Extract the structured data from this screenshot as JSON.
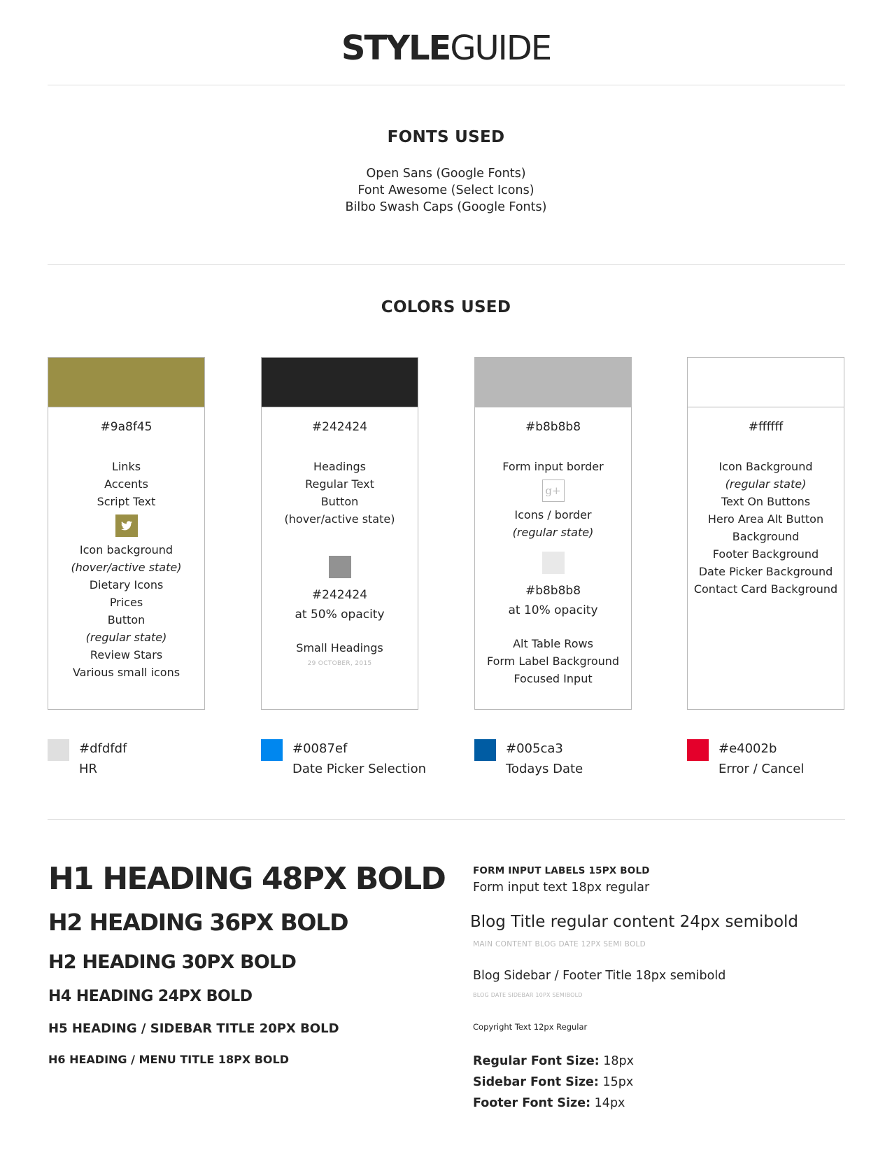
{
  "header": {
    "title_bold": "STYLE",
    "title_light": "GUIDE"
  },
  "fonts": {
    "heading": "FONTS USED",
    "items": [
      "Open Sans (Google Fonts)",
      "Font Awesome (Select Icons)",
      "Bilbo Swash Caps (Google Fonts)"
    ]
  },
  "colors": {
    "heading": "COLORS USED",
    "cards": [
      {
        "color": "#9a8f45",
        "hex": "#9a8f45",
        "uses_top": [
          "Links",
          "Accents",
          "Script Text"
        ],
        "icon": "twitter-icon",
        "uses_bottom": [
          "Icon background",
          "(hover/active state)",
          "Dietary Icons",
          "Prices",
          "Button",
          "(regular state)",
          "Review Stars",
          "Various small icons"
        ]
      },
      {
        "color": "#242424",
        "hex": "#242424",
        "uses_top": [
          "Headings",
          "Regular Text",
          "Button",
          "(hover/active state)"
        ],
        "variant_color": "#929292",
        "variant_hex": "#242424",
        "variant_note": "at 50% opacity",
        "variant_use": "Small Headings",
        "variant_sample": "29 OCTOBER, 2015"
      },
      {
        "color": "#b8b8b8",
        "hex": "#b8b8b8",
        "uses_top": [
          "Form input border"
        ],
        "icon": "google-plus-icon",
        "uses_mid": [
          "Icons / border",
          "(regular state)"
        ],
        "variant_color": "#e9e9e9",
        "variant_hex": "#b8b8b8",
        "variant_note": "at 10% opacity",
        "variant_uses": [
          "Alt Table Rows",
          "Form Label Background",
          "Focused Input"
        ]
      },
      {
        "color": "#ffffff",
        "hex": "#ffffff",
        "uses": [
          "Icon Background",
          "(regular state)",
          "Text On Buttons",
          "Hero Area Alt Button",
          "Background",
          "Footer Background",
          "Date Picker Background",
          "Contact Card Background"
        ]
      }
    ],
    "extras": [
      {
        "color": "#dfdfdf",
        "hex": "#dfdfdf",
        "use": "HR"
      },
      {
        "color": "#0087ef",
        "hex": "#0087ef",
        "use": "Date Picker Selection"
      },
      {
        "color": "#005ca3",
        "hex": "#005ca3",
        "use": "Todays Date"
      },
      {
        "color": "#e4002b",
        "hex": "#e4002b",
        "use": "Error / Cancel"
      }
    ]
  },
  "typography": {
    "headings": [
      "H1 HEADING 48PX BOLD",
      "H2 HEADING 36PX BOLD",
      "H2 HEADING 30PX BOLD",
      "H4 HEADING 24PX BOLD",
      "H5 HEADING / SIDEBAR TITLE 20PX BOLD",
      "H6 HEADING / MENU TITLE 18PX BOLD"
    ],
    "form_label": "FORM INPUT LABELS 15PX BOLD",
    "form_input": "Form input text 18px regular",
    "blog_title": "Blog Title regular content 24px semibold",
    "blog_date": "MAIN CONTENT BLOG DATE 12PX SEMI BOLD",
    "sidebar_title": "Blog Sidebar / Footer Title 18px semibold",
    "sidebar_date": "BLOG DATE SIDEBAR 10PX SEMIBOLD",
    "copyright": "Copyright Text 12px Regular",
    "font_sizes": [
      {
        "label": "Regular Font Size:",
        "value": "18px"
      },
      {
        "label": "Sidebar Font Size:",
        "value": "15px"
      },
      {
        "label": "Footer Font Size:",
        "value": "14px"
      }
    ]
  }
}
